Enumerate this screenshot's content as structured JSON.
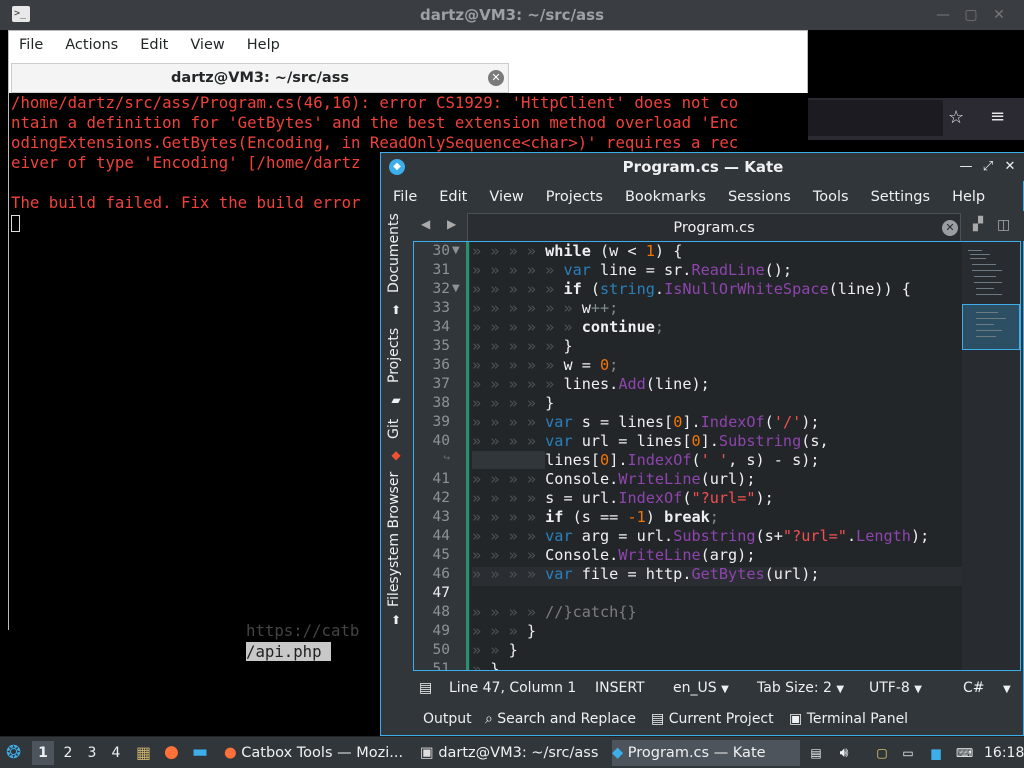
{
  "terminal": {
    "window_title": "dartz@VM3: ~/src/ass",
    "tab_title": "dartz@VM3: ~/src/ass",
    "menu": [
      "File",
      "Actions",
      "Edit",
      "View",
      "Help"
    ],
    "output_lines": [
      "/home/dartz/src/ass/Program.cs(46,16): error CS1929: 'HttpClient' does not co",
      "ntain a definition for 'GetBytes' and the best extension method overload 'Enc",
      "odingExtensions.GetBytes(Encoding, in ReadOnlySequence<char>)' requires a rec",
      "eiver of type 'Encoding' [/home/dartz",
      "",
      "The build failed. Fix the build error"
    ]
  },
  "background": {
    "lines": [
      "https://catb",
      "/api.php "
    ]
  },
  "kate": {
    "title": "Program.cs  — Kate",
    "menu": [
      "File",
      "Edit",
      "View",
      "Projects",
      "Bookmarks",
      "Sessions",
      "Tools",
      "Settings",
      "Help"
    ],
    "sidebar_tabs": [
      "Documents",
      "Projects",
      "Git",
      "Filesystem Browser"
    ],
    "tab_title": "Program.cs",
    "line_numbers": [
      "30",
      "31",
      "32",
      "33",
      "34",
      "35",
      "36",
      "37",
      "38",
      "39",
      "40",
      "",
      "41",
      "42",
      "43",
      "44",
      "45",
      "46",
      "47",
      "48",
      "49",
      "50",
      "51"
    ],
    "status": {
      "position": "Line 47, Column 1",
      "mode": "INSERT",
      "locale": "en_US",
      "tab_size": "Tab Size: 2",
      "encoding": "UTF-8",
      "language": "C#"
    },
    "bottom_tabs": [
      "Output",
      "Search and Replace",
      "Current Project",
      "Terminal Panel"
    ]
  },
  "taskbar": {
    "desktops": [
      "1",
      "2",
      "3",
      "4"
    ],
    "tasks": [
      "Catbox Tools — Mozi...",
      "dartz@VM3: ~/src/ass",
      "Program.cs  — Kate"
    ],
    "clock": "16:18"
  },
  "colors": {
    "kate_accent": "#3daee9",
    "terminal_error": "#f0423a",
    "editor_bg": "#232629"
  }
}
